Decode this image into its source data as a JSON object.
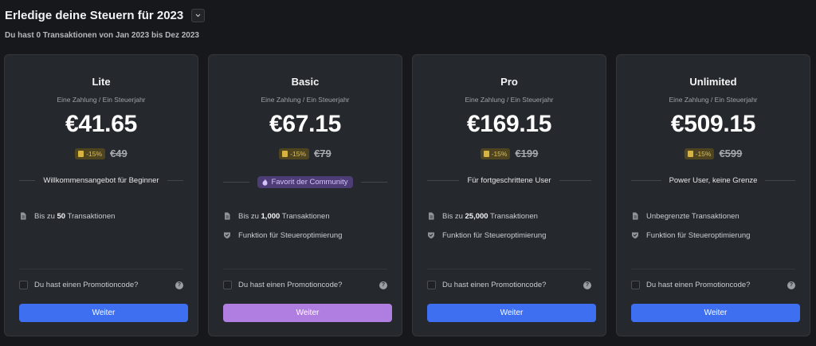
{
  "header": {
    "title": "Erledige deine Steuern für 2023",
    "subtitle": "Du hast 0 Transaktionen von Jan 2023 bis Dez 2023"
  },
  "colors": {
    "primary_button": "#3d6ff0",
    "featured_button": "#b07ee0",
    "discount_badge_bg": "#4e4420",
    "discount_badge_text": "#e2c04e",
    "community_pill_bg": "#4d3c75"
  },
  "plans": [
    {
      "name": "Lite",
      "frequency": "Eine Zahlung / Ein Steuerjahr",
      "price": "€41.65",
      "discount": "-15%",
      "old_price": "€49",
      "tagline": "Willkommensangebot für Beginner",
      "features": [
        {
          "icon": "document-icon",
          "pre": "Bis zu ",
          "bold": "50",
          "post": " Transaktionen"
        }
      ],
      "promo_label": "Du hast einen Promotioncode?",
      "help": "?",
      "button": "Weiter"
    },
    {
      "name": "Basic",
      "frequency": "Eine Zahlung / Ein Steuerjahr",
      "price": "€67.15",
      "discount": "-15%",
      "old_price": "€79",
      "tagline": "Favorit der Community",
      "features": [
        {
          "icon": "document-icon",
          "pre": "Bis zu ",
          "bold": "1,000",
          "post": " Transaktionen"
        },
        {
          "icon": "shield-icon",
          "pre": "Funktion für Steueroptimierung",
          "bold": "",
          "post": ""
        }
      ],
      "promo_label": "Du hast einen Promotioncode?",
      "help": "?",
      "button": "Weiter"
    },
    {
      "name": "Pro",
      "frequency": "Eine Zahlung / Ein Steuerjahr",
      "price": "€169.15",
      "discount": "-15%",
      "old_price": "€199",
      "tagline": "Für fortgeschrittene User",
      "features": [
        {
          "icon": "document-icon",
          "pre": "Bis zu ",
          "bold": "25,000",
          "post": " Transaktionen"
        },
        {
          "icon": "shield-icon",
          "pre": "Funktion für Steueroptimierung",
          "bold": "",
          "post": ""
        }
      ],
      "promo_label": "Du hast einen Promotioncode?",
      "help": "?",
      "button": "Weiter"
    },
    {
      "name": "Unlimited",
      "frequency": "Eine Zahlung / Ein Steuerjahr",
      "price": "€509.15",
      "discount": "-15%",
      "old_price": "€599",
      "tagline": "Power User, keine Grenze",
      "features": [
        {
          "icon": "document-icon",
          "pre": "Unbegrenzte Transaktionen",
          "bold": "",
          "post": ""
        },
        {
          "icon": "shield-icon",
          "pre": "Funktion für Steueroptimierung",
          "bold": "",
          "post": ""
        }
      ],
      "promo_label": "Du hast einen Promotioncode?",
      "help": "?",
      "button": "Weiter"
    }
  ]
}
